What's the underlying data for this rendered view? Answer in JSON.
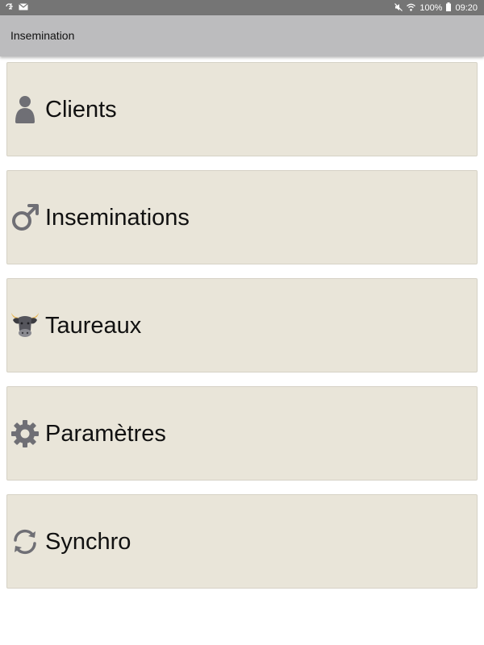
{
  "status_bar": {
    "icons_left": [
      "dnd-icon",
      "mail-icon"
    ],
    "icons_right": [
      "mute-icon",
      "wifi-icon",
      "battery-icon"
    ],
    "battery": "100%",
    "time": "09:20"
  },
  "app_bar": {
    "title": "Insemination"
  },
  "menu": {
    "items": [
      {
        "label": "Clients",
        "icon": "person-icon"
      },
      {
        "label": "Inseminations",
        "icon": "male-symbol-icon"
      },
      {
        "label": "Taureaux",
        "icon": "bull-icon"
      },
      {
        "label": "Paramètres",
        "icon": "gear-icon"
      },
      {
        "label": "Synchro",
        "icon": "sync-icon"
      }
    ]
  },
  "colors": {
    "status_bar": "#757575",
    "app_bar": "#bcbcbe",
    "card_bg": "#e9e5d9",
    "icon_gray": "#6f6f75"
  }
}
